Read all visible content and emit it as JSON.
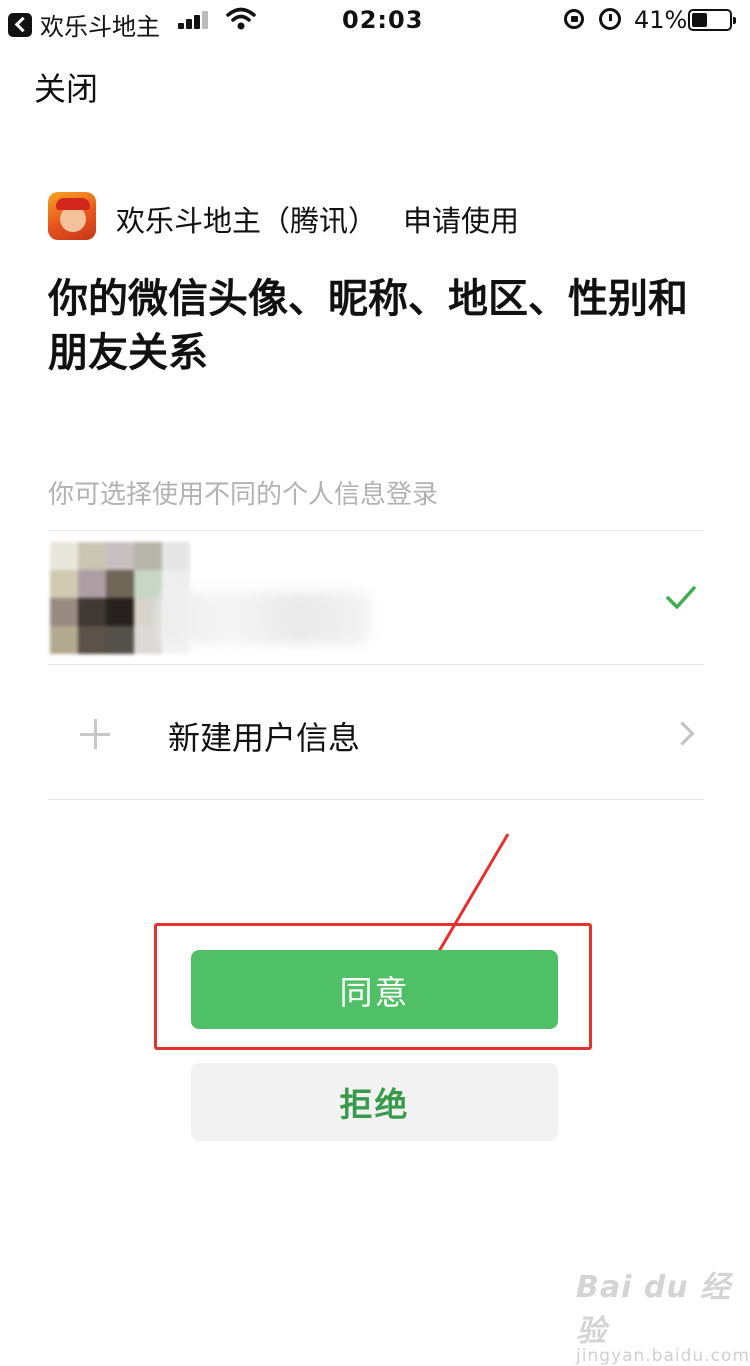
{
  "status_bar": {
    "back_app": "欢乐斗地主",
    "time": "02:03",
    "battery_percent": "41%",
    "battery_level": 0.41
  },
  "nav": {
    "close_label": "关闭"
  },
  "app": {
    "name": "欢乐斗地主（腾讯）",
    "request_text": "申请使用"
  },
  "heading": "你的微信头像、昵称、地区、性别和朋友关系",
  "hint": "你可选择使用不同的个人信息登录",
  "new_user": {
    "label": "新建用户信息"
  },
  "buttons": {
    "agree": "同意",
    "reject": "拒绝"
  },
  "colors": {
    "accent_green": "#50c066",
    "annotation_red": "#e53030"
  },
  "watermark": {
    "brand": "Bai du 经验",
    "url": "jingyan.baidu.com"
  }
}
